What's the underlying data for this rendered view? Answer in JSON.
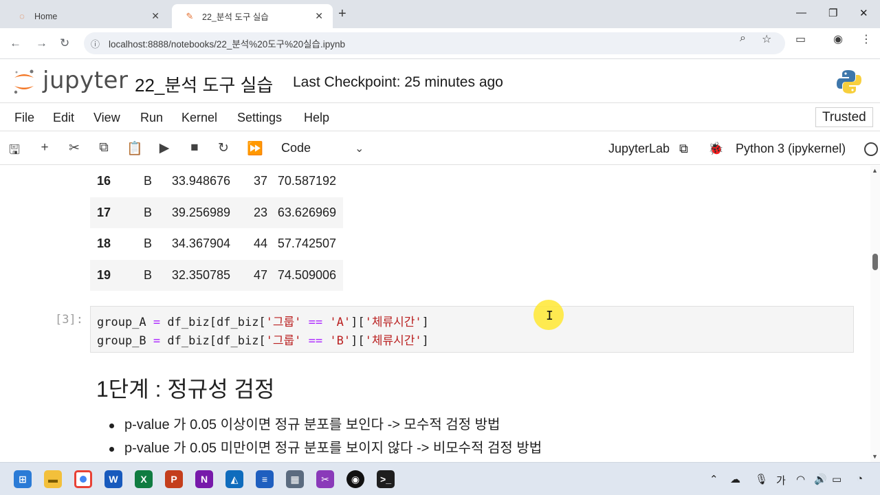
{
  "browser": {
    "tabs": [
      {
        "label": "Home"
      },
      {
        "label": "22_분석 도구 실습"
      }
    ],
    "url": "localhost:8888/notebooks/22_분석%20도구%20실습.ipynb"
  },
  "jupyter": {
    "logo_text": "jupyter",
    "notebook_title": "22_분석 도구 실습",
    "checkpoint": "Last Checkpoint: 25 minutes ago",
    "menu": [
      "File",
      "Edit",
      "View",
      "Run",
      "Kernel",
      "Settings",
      "Help"
    ],
    "trusted": "Trusted",
    "cell_type": "Code",
    "jupyterlab_link": "JupyterLab",
    "kernel_name": "Python 3 (ipykernel)"
  },
  "dataframe_rows": [
    {
      "idx": "16",
      "grp": "B",
      "c1": "33.948676",
      "c2": "37",
      "c3": "70.587192"
    },
    {
      "idx": "17",
      "grp": "B",
      "c1": "39.256989",
      "c2": "23",
      "c3": "63.626969"
    },
    {
      "idx": "18",
      "grp": "B",
      "c1": "34.367904",
      "c2": "44",
      "c3": "57.742507"
    },
    {
      "idx": "19",
      "grp": "B",
      "c1": "32.350785",
      "c2": "47",
      "c3": "74.509006"
    }
  ],
  "code_cell": {
    "prompt": "[3]:",
    "line1": {
      "var": "group_A",
      "eq": " = ",
      "a": "df_biz[df_biz[",
      "s1": "'그룹'",
      "op": " == ",
      "s2": "'A'",
      "b": "][",
      "s3": "'체류시간'",
      "c": "]"
    },
    "line2": {
      "var": "group_B",
      "eq": " = ",
      "a": "df_biz[df_biz[",
      "s1": "'그룹'",
      "op": " == ",
      "s2": "'B'",
      "b": "][",
      "s3": "'체류시간'",
      "c": "]"
    }
  },
  "markdown": {
    "heading": "1단계 : 정규성 검정",
    "bullets": [
      "p-value 가 0.05 이상이면 정규 분포를 보인다 -> 모수적 검정 방법",
      "p-value 가 0.05 미만이면 정규 분포를 보이지 않다 -> 비모수적 검정 방법"
    ]
  },
  "taskbar": {
    "ime": "가"
  },
  "colors": {
    "string": "#ba2121",
    "operator": "#aa22ff",
    "jupyter_orange": "#f37726"
  }
}
